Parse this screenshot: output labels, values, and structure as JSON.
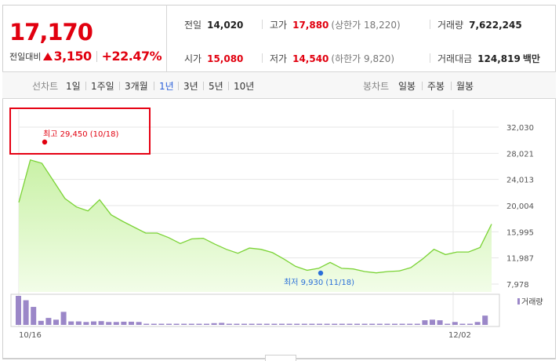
{
  "summary": {
    "current_price": "17,170",
    "change_label": "전일대비",
    "change_amount": "3,150",
    "change_percent": "+22.47%",
    "prev_close": {
      "label": "전일",
      "value": "14,020"
    },
    "open": {
      "label": "시가",
      "value": "15,080"
    },
    "high": {
      "label": "고가",
      "value": "17,880",
      "sub": "(상한가 18,220)"
    },
    "low": {
      "label": "저가",
      "value": "14,540",
      "sub": "(하한가 9,820)"
    },
    "volume": {
      "label": "거래량",
      "value": "7,622,245"
    },
    "trade_value": {
      "label": "거래대금",
      "value": "124,819",
      "unit": "백만"
    }
  },
  "tabs": {
    "line_label": "선차트",
    "periods": [
      "1일",
      "1주일",
      "3개월",
      "1년",
      "3년",
      "5년",
      "10년"
    ],
    "active_period": "1년",
    "candle_label": "봉차트",
    "candles": [
      "일봉",
      "주봉",
      "월봉"
    ]
  },
  "colors": {
    "up": "#e1000f",
    "line": "#7bd336",
    "fill_top": "#c9f1a6",
    "fill_bottom": "#f2fde8",
    "volume": "#9b87c8",
    "low_marker": "#2a6fd9",
    "high_marker": "#e1000f",
    "active_tab": "#2a5fd9"
  },
  "chart_data": {
    "type": "area",
    "y_ticks": [
      "32,030",
      "28,021",
      "24,013",
      "20,004",
      "15,995",
      "11,987",
      "7,978"
    ],
    "ylim": [
      7978,
      32030
    ],
    "x_labels": [
      "10/16",
      "12/02"
    ],
    "series": [
      {
        "values": [
          20500,
          27000,
          26500,
          23800,
          21100,
          19800,
          19200,
          20900,
          18600,
          17600,
          16700,
          15800,
          15800,
          15100,
          14200,
          14900,
          15000,
          14100,
          13300,
          12700,
          13500,
          13300,
          12800,
          11800,
          10700,
          10100,
          10400,
          11300,
          10400,
          10300,
          9900,
          9700,
          9900,
          10000,
          10500,
          11800,
          13300,
          12500,
          12900,
          12900,
          13600,
          17170
        ]
      }
    ],
    "high_annotation": {
      "label": "최고",
      "value": "29,450",
      "date": "(10/18)"
    },
    "low_annotation": {
      "label": "최저",
      "value": "9,930",
      "date": "(11/18)"
    },
    "volume": {
      "label": "거래량",
      "values": [
        1.0,
        0.85,
        0.62,
        0.14,
        0.24,
        0.18,
        0.45,
        0.12,
        0.12,
        0.1,
        0.12,
        0.13,
        0.1,
        0.1,
        0.11,
        0.11,
        0.1,
        0.04,
        0.04,
        0.04,
        0.04,
        0.04,
        0.04,
        0.04,
        0.04,
        0.04,
        0.06,
        0.07,
        0.04,
        0.04,
        0.04,
        0.04,
        0.04,
        0.04,
        0.04,
        0.04,
        0.04,
        0.04,
        0.04,
        0.04,
        0.04,
        0.04,
        0.04,
        0.04,
        0.04,
        0.04,
        0.04,
        0.04,
        0.04,
        0.04,
        0.04,
        0.04,
        0.04,
        0.04,
        0.16,
        0.18,
        0.16,
        0.04,
        0.1,
        0.04,
        0.04,
        0.1,
        0.32
      ]
    }
  }
}
